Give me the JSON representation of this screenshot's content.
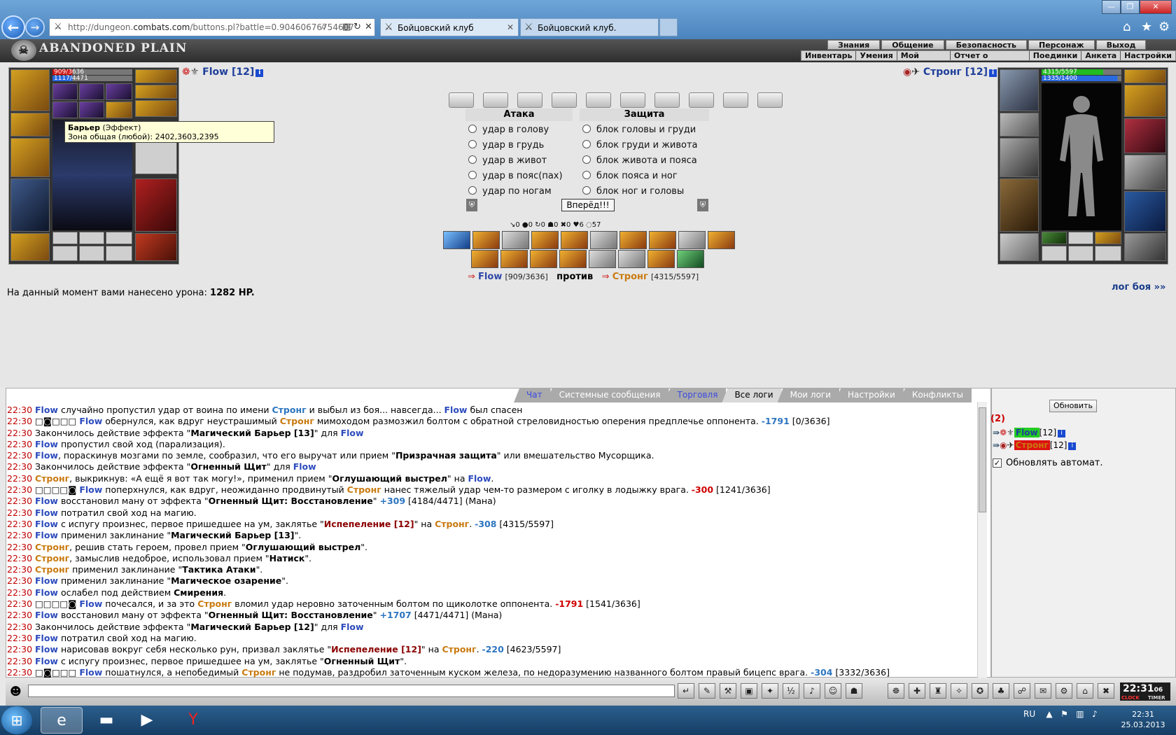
{
  "browser": {
    "url_prefix": "http://dungeon.",
    "url_domain": "combats.com",
    "url_rest": "/buttons.pl?battle=0.90460676754607",
    "tabs": [
      {
        "label": "Бойцовский клуб"
      },
      {
        "label": "Бойцовский клуб."
      }
    ],
    "window_controls": [
      "—",
      "❐",
      "✕"
    ],
    "toolbar_icons": [
      "home-icon",
      "star-icon",
      "gear-icon"
    ]
  },
  "game": {
    "logo": "ABANDONED PLAIN",
    "menu_top": [
      "Знания",
      "Общение",
      "Безопасность",
      "Персонаж",
      "Выход"
    ],
    "menu_bottom": [
      "Инвентарь",
      "Умения",
      "Мой Скролл",
      "Отчет о переводах",
      "Поединки",
      "Анкета",
      "Настройки"
    ]
  },
  "left_player": {
    "name": "Flow [12]",
    "hp": "909/3636",
    "mana": "1117/4471",
    "hp_frac": 0.25,
    "mana_frac": 0.25
  },
  "right_player": {
    "name": "Стронг [12]",
    "hp": "4315/5597",
    "mana": "1335/1400",
    "hp_frac": 0.77,
    "mana_frac": 0.95
  },
  "tooltip": {
    "title": "Барьер",
    "type": " (Эффект)",
    "line": "Зона общая (любой): 2402,3603,2395"
  },
  "attack": {
    "header": "Атака",
    "options": [
      "удар в голову",
      "удар в грудь",
      "удар в живот",
      "удар в пояс(пах)",
      "удар по ногам"
    ]
  },
  "defense": {
    "header": "Защита",
    "options": [
      "блок головы и груди",
      "блок груди и живота",
      "блок живота и пояса",
      "блок пояса и ног",
      "блок ног и головы"
    ]
  },
  "forward_button": "Вперёд!!!",
  "stats": "↘0  ●0  ↻0  ☗0  ✖0  ♥6  ◌57",
  "versus": {
    "left_name": "Flow",
    "left_hp": "[909/3636]",
    "mid": "против",
    "right_name": "Стронг",
    "right_hp": "[4315/5597]"
  },
  "damage": {
    "prefix": "На данный момент вами нанесено урона: ",
    "value": "1282 HP."
  },
  "log_link": "лог боя »»",
  "chat_tabs": [
    "Чат",
    "Системные сообщения",
    "Торговля",
    "Все логи",
    "Мои логи",
    "Настройки",
    "Конфликты"
  ],
  "log": [
    [
      [
        "t",
        "22:30 "
      ],
      [
        "f",
        "Flow"
      ],
      [
        "",
        " случайно пропустил удар от воина по имени "
      ],
      [
        "n",
        "Стронг"
      ],
      [
        "",
        " и выбыл из боя... навсегда... "
      ],
      [
        "f",
        "Flow"
      ],
      [
        "",
        " был спасен"
      ]
    ],
    [
      [
        "t",
        "22:30 "
      ],
      [
        "",
        "□◙□□□ "
      ],
      [
        "f",
        "Flow"
      ],
      [
        "",
        " обернулся, как вдруг неустрашимый "
      ],
      [
        "s",
        "Стронг"
      ],
      [
        "",
        " мимоходом размозжил болтом с обратной стреловидностью оперения предплечье оппонента. "
      ],
      [
        "n",
        "-1791"
      ],
      [
        "",
        " [0/3636]"
      ]
    ],
    [
      [
        "t",
        "22:30 "
      ],
      [
        "",
        "Закончилось действие эффекта \""
      ],
      [
        "b",
        "Магический Барьер [13]"
      ],
      [
        "",
        "\" для "
      ],
      [
        "f",
        "Flow"
      ]
    ],
    [
      [
        "t",
        "22:30 "
      ],
      [
        "f",
        "Flow"
      ],
      [
        "",
        " пропустил свой ход (парализация)."
      ]
    ],
    [
      [
        "t",
        "22:30 "
      ],
      [
        "f",
        "Flow"
      ],
      [
        "",
        ", пораскинув мозгами по земле, сообразил, что его выручат или прием \""
      ],
      [
        "b",
        "Призрачная защита"
      ],
      [
        "",
        "\" или вмешательство Мусорщика."
      ]
    ],
    [
      [
        "t",
        "22:30 "
      ],
      [
        "",
        "Закончилось действие эффекта \""
      ],
      [
        "b",
        "Огненный Щит"
      ],
      [
        "",
        "\" для "
      ],
      [
        "f",
        "Flow"
      ]
    ],
    [
      [
        "t",
        "22:30 "
      ],
      [
        "s",
        "Стронг"
      ],
      [
        "",
        ", выкрикнув: «А ещё я вот так могу!», применил прием \""
      ],
      [
        "b",
        "Оглушающий выстрел"
      ],
      [
        "",
        "\" на "
      ],
      [
        "f",
        "Flow"
      ],
      [
        "",
        "."
      ]
    ],
    [
      [
        "t",
        "22:30 "
      ],
      [
        "",
        "□□□□◙ "
      ],
      [
        "f",
        "Flow"
      ],
      [
        "",
        " поперхнулся, как вдруг, неожиданно продвинутый "
      ],
      [
        "s",
        "Стронг"
      ],
      [
        "",
        " нанес тяжелый удар чем-то размером с иголку в лодыжку врага. "
      ],
      [
        "r",
        "-300"
      ],
      [
        "",
        " [1241/3636]"
      ]
    ],
    [
      [
        "t",
        "22:30 "
      ],
      [
        "f",
        "Flow"
      ],
      [
        "",
        " восстановил ману от эффекта \""
      ],
      [
        "b",
        "Огненный Щит: Восстановление"
      ],
      [
        "",
        "\" "
      ],
      [
        "n",
        "+309"
      ],
      [
        "",
        " [4184/4471] (Мана)"
      ]
    ],
    [
      [
        "t",
        "22:30 "
      ],
      [
        "f",
        "Flow"
      ],
      [
        "",
        " потратил свой ход на магию."
      ]
    ],
    [
      [
        "t",
        "22:30 "
      ],
      [
        "f",
        "Flow"
      ],
      [
        "",
        " с испугу произнес, первое пришедшее на ум, заклятье \""
      ],
      [
        "d",
        "Испепеление [12]"
      ],
      [
        "",
        "\" на "
      ],
      [
        "s",
        "Стронг"
      ],
      [
        "",
        ". "
      ],
      [
        "n",
        "-308"
      ],
      [
        "",
        " [4315/5597]"
      ]
    ],
    [
      [
        "t",
        "22:30 "
      ],
      [
        "f",
        "Flow"
      ],
      [
        "",
        " применил заклинание \""
      ],
      [
        "b",
        "Магический Барьер [13]"
      ],
      [
        "",
        "\"."
      ]
    ],
    [
      [
        "t",
        "22:30 "
      ],
      [
        "s",
        "Стронг"
      ],
      [
        "",
        ", решив стать героем, провел прием \""
      ],
      [
        "b",
        "Оглушающий выстрел"
      ],
      [
        "",
        "\"."
      ]
    ],
    [
      [
        "t",
        "22:30 "
      ],
      [
        "s",
        "Стронг"
      ],
      [
        "",
        ", замыслив недоброе, использовал прием \""
      ],
      [
        "b",
        "Натиск"
      ],
      [
        "",
        "\"."
      ]
    ],
    [
      [
        "t",
        "22:30 "
      ],
      [
        "s",
        "Стронг"
      ],
      [
        "",
        " применил заклинание \""
      ],
      [
        "b",
        "Тактика Атаки"
      ],
      [
        "",
        "\"."
      ]
    ],
    [
      [
        "t",
        "22:30 "
      ],
      [
        "f",
        "Flow"
      ],
      [
        "",
        " применил заклинание \""
      ],
      [
        "b",
        "Магическое озарение"
      ],
      [
        "",
        "\"."
      ]
    ],
    [
      [
        "t",
        "22:30 "
      ],
      [
        "f",
        "Flow"
      ],
      [
        "",
        " ослабел под действием "
      ],
      [
        "b",
        "Смирения"
      ],
      [
        "",
        "."
      ]
    ],
    [
      [
        "t",
        "22:30 "
      ],
      [
        "",
        "□□□□◙ "
      ],
      [
        "f",
        "Flow"
      ],
      [
        "",
        " почесался, и за это "
      ],
      [
        "s",
        "Стронг"
      ],
      [
        "",
        " вломил удар неровно заточенным болтом по щиколотке оппонента. "
      ],
      [
        "r",
        "-1791"
      ],
      [
        "",
        " [1541/3636]"
      ]
    ],
    [
      [
        "t",
        "22:30 "
      ],
      [
        "f",
        "Flow"
      ],
      [
        "",
        " восстановил ману от эффекта \""
      ],
      [
        "b",
        "Огненный Щит: Восстановление"
      ],
      [
        "",
        "\" "
      ],
      [
        "n",
        "+1707"
      ],
      [
        "",
        " [4471/4471] (Мана)"
      ]
    ],
    [
      [
        "t",
        "22:30 "
      ],
      [
        "",
        "Закончилось действие эффекта \""
      ],
      [
        "b",
        "Магический Барьер [12]"
      ],
      [
        "",
        "\" для "
      ],
      [
        "f",
        "Flow"
      ]
    ],
    [
      [
        "t",
        "22:30 "
      ],
      [
        "f",
        "Flow"
      ],
      [
        "",
        " потратил свой ход на магию."
      ]
    ],
    [
      [
        "t",
        "22:30 "
      ],
      [
        "f",
        "Flow"
      ],
      [
        "",
        " нарисовав вокруг себя несколько рун, призвал заклятье \""
      ],
      [
        "d",
        "Испепеление [12]"
      ],
      [
        "",
        "\" на "
      ],
      [
        "s",
        "Стронг"
      ],
      [
        "",
        ". "
      ],
      [
        "n",
        "-220"
      ],
      [
        "",
        " [4623/5597]"
      ]
    ],
    [
      [
        "t",
        "22:30 "
      ],
      [
        "f",
        "Flow"
      ],
      [
        "",
        " с испугу произнес, первое пришедшее на ум, заклятье \""
      ],
      [
        "b",
        "Огненный Щит"
      ],
      [
        "",
        "\"."
      ]
    ],
    [
      [
        "t",
        "22:30 "
      ],
      [
        "",
        "□◙□□□ "
      ],
      [
        "f",
        "Flow"
      ],
      [
        "",
        " пошатнулся, а непобедимый "
      ],
      [
        "s",
        "Стронг"
      ],
      [
        "",
        " не подумав, раздробил заточенным куском железа, по недоразумению названного болтом правый бицепс врага. "
      ],
      [
        "n",
        "-304"
      ],
      [
        "",
        " [3332/3636]"
      ]
    ]
  ],
  "right_panel": {
    "refresh": "Обновить",
    "count": "(2)",
    "p1_name": "Flow",
    "p1_level": "[12]",
    "p2_name": "Стронг",
    "p2_level": "[12]",
    "auto_refresh": "Обновлять автомат.",
    "auto_check": "✓"
  },
  "bottom_clock": {
    "time": "22:31",
    "sec": "06",
    "clock_label": "CLOCK",
    "timer_label": "TIMER"
  },
  "taskbar": {
    "lang": "RU",
    "time": "22:31",
    "date": "25.03.2013"
  },
  "colors": {
    "flow": "#2c4bbd",
    "strong": "#c97a10",
    "time": "#c00000",
    "hp_bar": "#cc1111",
    "mana_bar": "#2a6adf",
    "hp_bar_right": "#22bb22"
  }
}
